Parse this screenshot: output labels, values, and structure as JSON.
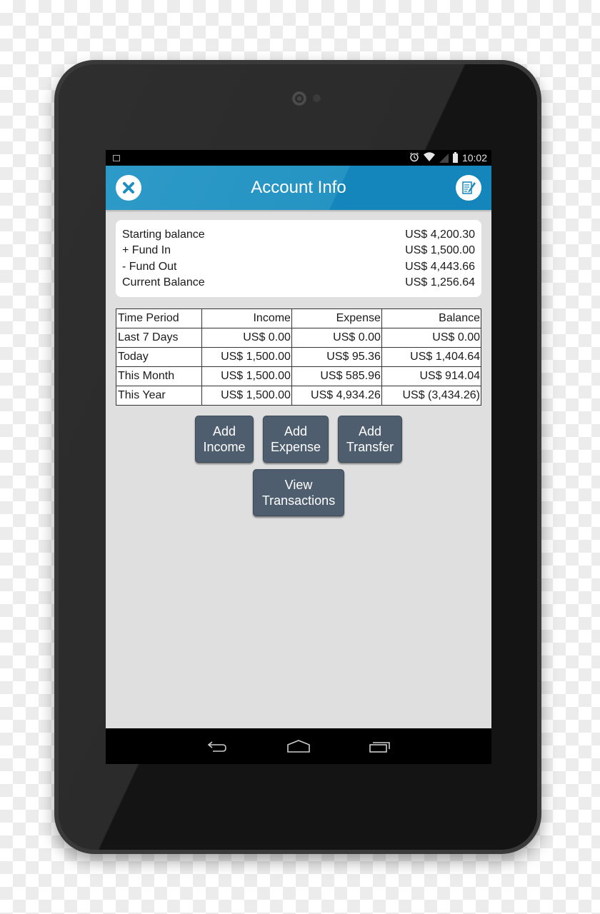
{
  "status_bar": {
    "notification_icon": "picture-icon",
    "icons": [
      "alarm-icon",
      "wifi-icon",
      "signal-icon",
      "battery-icon"
    ],
    "time": "10:02"
  },
  "app_bar": {
    "title": "Account Info",
    "left_icon": "close-icon",
    "right_icon": "edit-note-icon",
    "color": "#2594c3"
  },
  "summary": {
    "rows": [
      {
        "label": "Starting balance",
        "value": "US$ 4,200.30"
      },
      {
        "label": "+ Fund In",
        "value": "US$ 1,500.00"
      },
      {
        "label": "- Fund Out",
        "value": "US$ 4,443.66"
      },
      {
        "label": "Current Balance",
        "value": "US$ 1,256.64"
      }
    ]
  },
  "period_table": {
    "headers": [
      "Time Period",
      "Income",
      "Expense",
      "Balance"
    ],
    "rows": [
      [
        "Last 7 Days",
        "US$ 0.00",
        "US$ 0.00",
        "US$ 0.00"
      ],
      [
        "Today",
        "US$ 1,500.00",
        "US$ 95.36",
        "US$ 1,404.64"
      ],
      [
        "This Month",
        "US$ 1,500.00",
        "US$ 585.96",
        "US$ 914.04"
      ],
      [
        "This Year",
        "US$ 1,500.00",
        "US$ 4,934.26",
        "US$ (3,434.26)"
      ]
    ]
  },
  "actions": {
    "add_income": [
      "Add",
      "Income"
    ],
    "add_expense": [
      "Add",
      "Expense"
    ],
    "add_transfer": [
      "Add",
      "Transfer"
    ],
    "view_transactions": [
      "View",
      "Transactions"
    ],
    "button_color": "#4e5e6e"
  },
  "nav_bar": {
    "icons": [
      "back-icon",
      "home-icon",
      "recent-apps-icon"
    ]
  }
}
